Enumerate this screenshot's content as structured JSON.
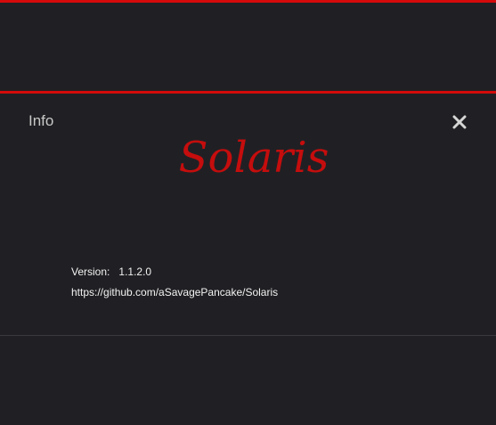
{
  "dialog": {
    "title": "Info",
    "close_icon": "close-icon",
    "logo_text": "Solaris",
    "version_label": "Version:",
    "version_value": "1.1.2.0",
    "repo_link": "https://github.com/aSavagePancake/Solaris"
  },
  "colors": {
    "accent": "#d40a0a",
    "background": "#202024",
    "title_text": "#c8c8c8",
    "body_text": "#f2f2f2"
  }
}
